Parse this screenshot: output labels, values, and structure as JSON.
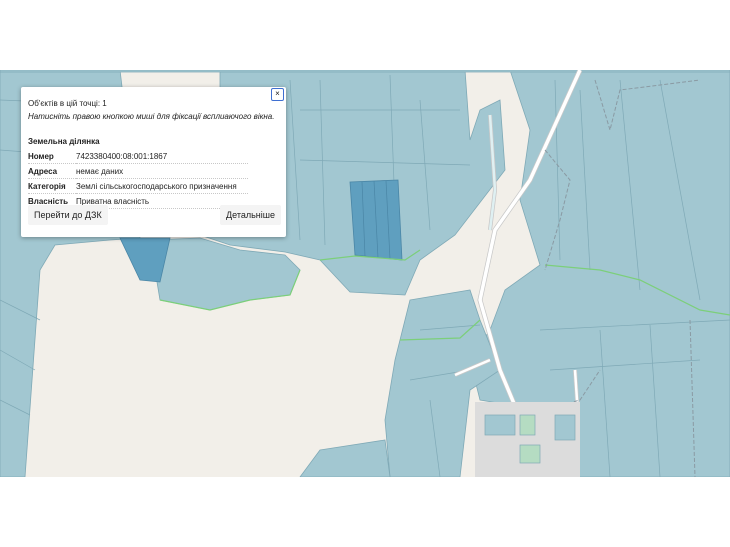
{
  "colors": {
    "background": "#f2efe9",
    "parcel_fill": "#a2c7d1",
    "parcel_stroke": "#7fa9b6",
    "parcel_selected": "#5f9fbf",
    "green_border": "#7ccf7a",
    "road": "#ffffff",
    "urban": "#dcdcdc"
  },
  "popup": {
    "close_icon": "close-icon",
    "close_glyph": "×",
    "objects_count": "Об'єктів в цій точці: 1",
    "hint": "Натисніть правою кнопкою миші для фіксації всплиаючого вікна.",
    "section_title": "Земельна ділянка",
    "rows": [
      {
        "key": "Номер",
        "value": "7423380400:08:001:1867"
      },
      {
        "key": "Адреса",
        "value": "немає даних"
      },
      {
        "key": "Категорія",
        "value": "Землі сільськогосподарського призначення"
      },
      {
        "key": "Власність",
        "value": "Приватна власність"
      }
    ],
    "button_dzk": "Перейти до ДЗК",
    "button_details": "Детальніше"
  }
}
